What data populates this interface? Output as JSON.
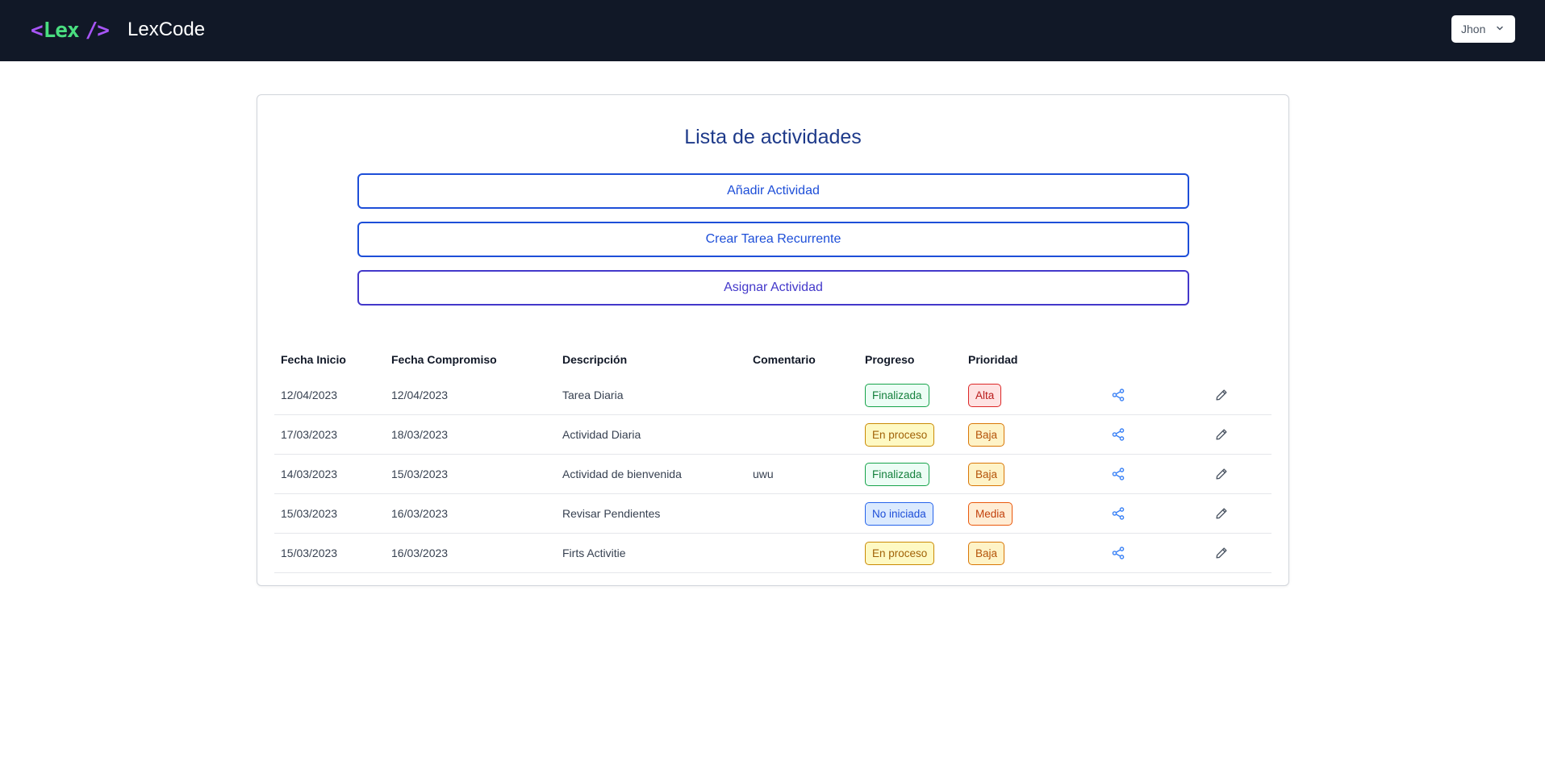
{
  "header": {
    "logo_lt": "<",
    "logo_word": "Lex",
    "logo_slash": "/>",
    "app_name": "LexCode",
    "user_name": "Jhon"
  },
  "main": {
    "title": "Lista de actividades",
    "buttons": {
      "add": "Añadir Actividad",
      "recurrent": "Crear Tarea Recurrente",
      "assign": "Asignar Actividad"
    }
  },
  "table": {
    "columns": [
      "Fecha Inicio",
      "Fecha Compromiso",
      "Descripción",
      "Comentario",
      "Progreso",
      "Prioridad"
    ],
    "rows": [
      {
        "start": "12/04/2023",
        "due": "12/04/2023",
        "description": "Tarea Diaria",
        "comment": "",
        "progress": "Finalizada",
        "priority": "Alta"
      },
      {
        "start": "17/03/2023",
        "due": "18/03/2023",
        "description": "Actividad Diaria",
        "comment": "",
        "progress": "En proceso",
        "priority": "Baja"
      },
      {
        "start": "14/03/2023",
        "due": "15/03/2023",
        "description": "Actividad de bienvenida",
        "comment": "uwu",
        "progress": "Finalizada",
        "priority": "Baja"
      },
      {
        "start": "15/03/2023",
        "due": "16/03/2023",
        "description": "Revisar Pendientes",
        "comment": "",
        "progress": "No iniciada",
        "priority": "Media"
      },
      {
        "start": "15/03/2023",
        "due": "16/03/2023",
        "description": "Firts Activitie",
        "comment": "",
        "progress": "En proceso",
        "priority": "Baja"
      }
    ],
    "row_icons": [
      "share-icon",
      "pencil-icon"
    ]
  },
  "colors": {
    "navbar": "#111827",
    "accent": "#1d4ed8",
    "status": {
      "Finalizada": {
        "bg": "#ecfdf5",
        "border": "#16a34a",
        "text": "#15803d"
      },
      "En proceso": {
        "bg": "#fef9c3",
        "border": "#ca8a04",
        "text": "#a16207"
      },
      "No iniciada": {
        "bg": "#dbeafe",
        "border": "#2563eb",
        "text": "#1d4ed8"
      }
    },
    "priority": {
      "Alta": {
        "bg": "#fee2e2",
        "border": "#dc2626",
        "text": "#b91c1c"
      },
      "Baja": {
        "bg": "#fef3c7",
        "border": "#d97706",
        "text": "#b45309"
      },
      "Media": {
        "bg": "#ffedd5",
        "border": "#ea580c",
        "text": "#c2410c"
      }
    }
  }
}
